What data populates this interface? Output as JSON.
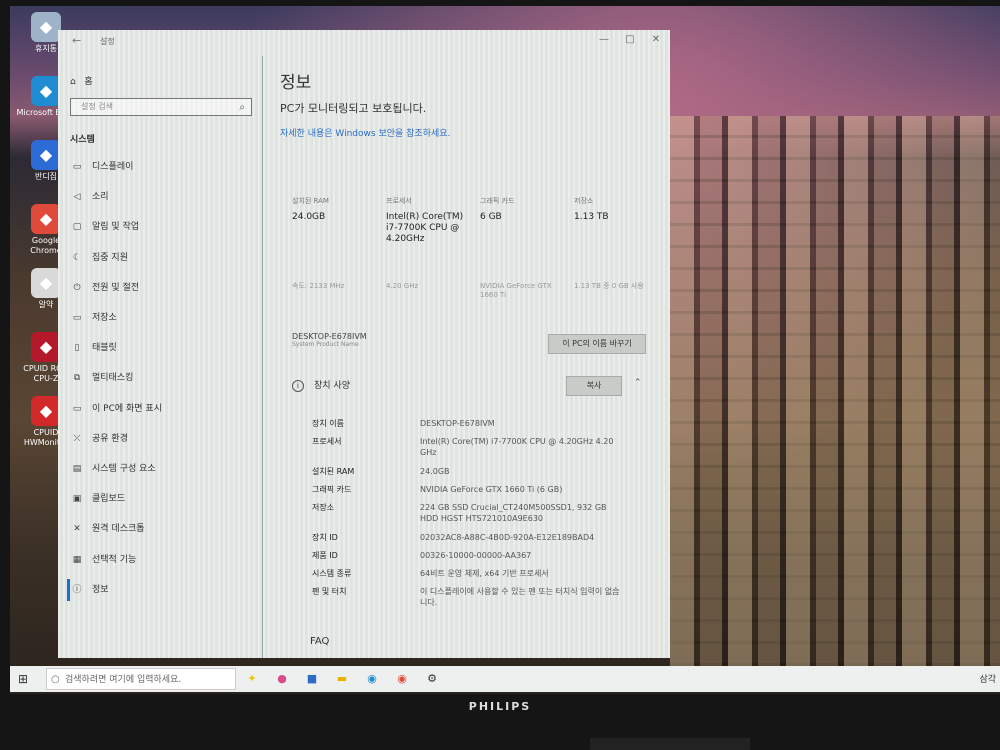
{
  "desktop": {
    "icons": [
      {
        "label": "휴지통",
        "icon": "recycle-bin-icon",
        "color": "#9fb3c8"
      },
      {
        "label": "Microsoft Edge",
        "icon": "edge-icon",
        "color": "#1f8bd0"
      },
      {
        "label": "반디집",
        "icon": "bandizip-icon",
        "color": "#2c6ad6"
      },
      {
        "label": "Google Chrome",
        "icon": "chrome-icon",
        "color": "#e04a3b"
      },
      {
        "label": "알약",
        "icon": "alyac-icon",
        "color": "#d9d9d9"
      },
      {
        "label": "CPUID ROG CPU-Z",
        "icon": "cpuz-icon",
        "color": "#b3192a"
      },
      {
        "label": "CPUID HWMonitor",
        "icon": "hwmonitor-icon",
        "color": "#d22a2a"
      }
    ]
  },
  "window": {
    "title": "설정",
    "nav": {
      "home": "홈",
      "search_placeholder": "설정 검색",
      "section": "시스템",
      "items": [
        {
          "label": "디스플레이",
          "icon": "display-icon"
        },
        {
          "label": "소리",
          "icon": "sound-icon"
        },
        {
          "label": "알림 및 작업",
          "icon": "notifications-icon"
        },
        {
          "label": "집중 지원",
          "icon": "focus-assist-icon"
        },
        {
          "label": "전원 및 절전",
          "icon": "power-icon"
        },
        {
          "label": "저장소",
          "icon": "storage-icon"
        },
        {
          "label": "태블릿",
          "icon": "tablet-icon"
        },
        {
          "label": "멀티태스킹",
          "icon": "multitasking-icon"
        },
        {
          "label": "이 PC에 화면 표시",
          "icon": "projecting-icon"
        },
        {
          "label": "공유 환경",
          "icon": "shared-experiences-icon"
        },
        {
          "label": "시스템 구성 요소",
          "icon": "system-components-icon"
        },
        {
          "label": "클립보드",
          "icon": "clipboard-icon"
        },
        {
          "label": "원격 데스크톱",
          "icon": "remote-desktop-icon"
        },
        {
          "label": "선택적 기능",
          "icon": "optional-features-icon"
        },
        {
          "label": "정보",
          "icon": "info-icon",
          "active": true
        }
      ]
    },
    "main": {
      "title": "정보",
      "subtitle": "PC가 모니터링되고 보호됩니다.",
      "link": "자세한 내용은 Windows 보안을 참조하세요.",
      "specs": [
        {
          "label": "설치된 RAM",
          "value": "24.0GB",
          "sub": "속도: 2133 MHz"
        },
        {
          "label": "프로세서",
          "value": "Intel(R) Core(TM) i7-7700K CPU @ 4.20GHz",
          "sub": "4.20 GHz"
        },
        {
          "label": "그래픽 카드",
          "value": "6 GB",
          "sub": "NVIDIA GeForce GTX 1660 Ti"
        },
        {
          "label": "저장소",
          "value": "1.13 TB",
          "sub": "1.13 TB 중 0 GB 사용"
        }
      ],
      "device_name": "DESKTOP-E678IVM",
      "device_name_caption": "System Product Name",
      "rename_button": "이 PC의 이름 바꾸기",
      "device_spec_heading": "장치 사양",
      "copy_button": "복사",
      "device_specs": [
        {
          "key": "장치 이름",
          "value": "DESKTOP-E678IVM"
        },
        {
          "key": "프로세서",
          "value": "Intel(R) Core(TM) i7-7700K CPU @ 4.20GHz 4.20 GHz"
        },
        {
          "key": "설치된 RAM",
          "value": "24.0GB"
        },
        {
          "key": "그래픽 카드",
          "value": "NVIDIA GeForce GTX 1660 Ti (6 GB)"
        },
        {
          "key": "저장소",
          "value": "224 GB SSD Crucial_CT240M500SSD1, 932 GB HDD HGST HTS721010A9E630"
        },
        {
          "key": "장치 ID",
          "value": "02032AC8-A88C-4B0D-920A-E12E189BAD4"
        },
        {
          "key": "제품 ID",
          "value": "00326-10000-00000-AA367"
        },
        {
          "key": "시스템 종류",
          "value": "64비트 운영 체제, x64 기반 프로세서"
        },
        {
          "key": "펜 및 터치",
          "value": "이 디스플레이에 사용할 수 있는 펜 또는 터치식 입력이 없습니다."
        }
      ],
      "faq": "FAQ"
    }
  },
  "taskbar": {
    "search_placeholder": "검색하려면 여기에 입력하세요.",
    "tray_text": "삼각",
    "icons": [
      {
        "name": "widgets-icon",
        "glyph": "✦",
        "color": "#f2c200"
      },
      {
        "name": "colorful-app-icon",
        "glyph": "●",
        "color": "#d94c8c"
      },
      {
        "name": "store-icon",
        "glyph": "■",
        "color": "#2b6cc4"
      },
      {
        "name": "file-explorer-icon",
        "glyph": "▬",
        "color": "#e8b400"
      },
      {
        "name": "edge-icon",
        "glyph": "◉",
        "color": "#1f8bd0"
      },
      {
        "name": "chrome-icon",
        "glyph": "◉",
        "color": "#e04a3b"
      },
      {
        "name": "settings-gear-icon",
        "glyph": "⚙",
        "color": "#333333"
      }
    ]
  },
  "monitor": {
    "brand": "PHILIPS"
  }
}
